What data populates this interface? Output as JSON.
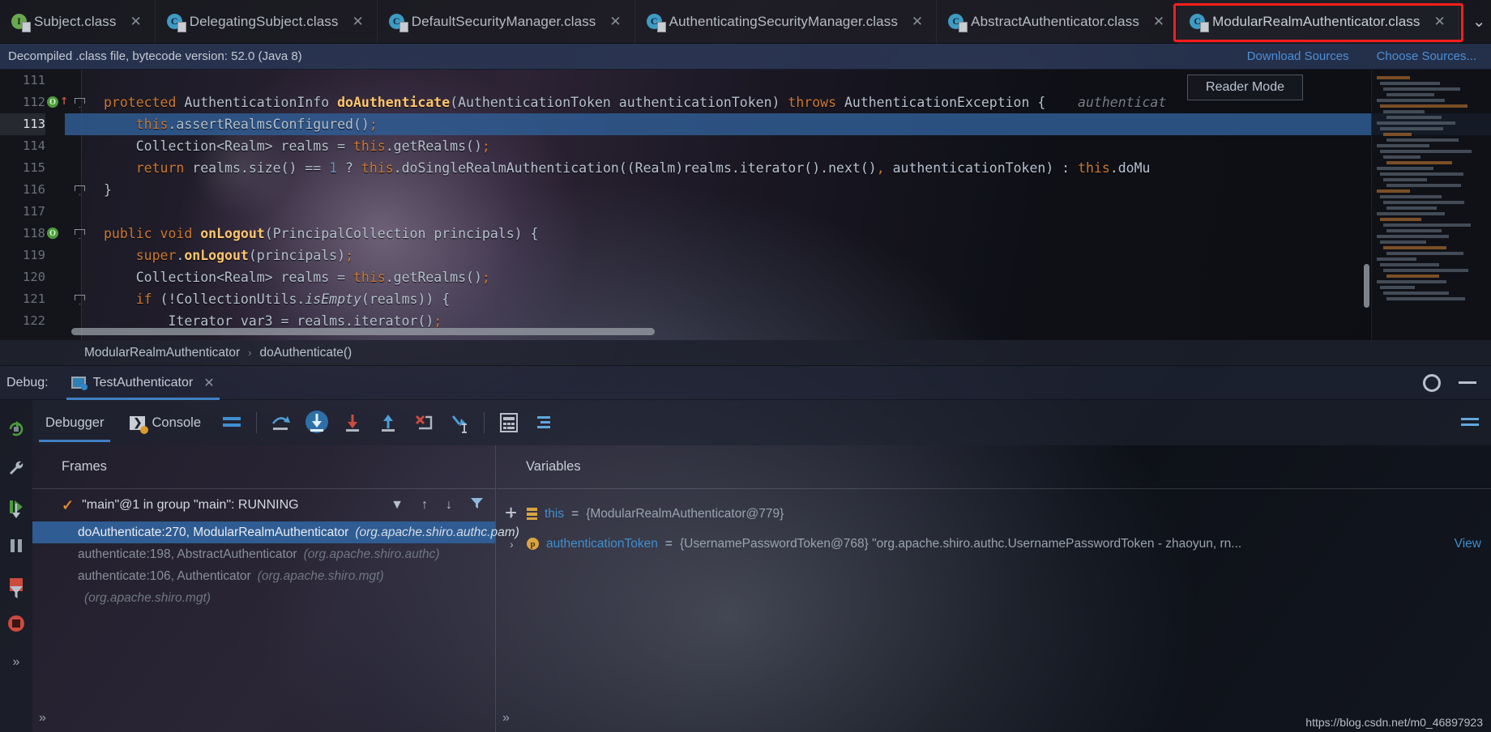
{
  "tabs": [
    {
      "label": "Subject.class",
      "icon": "interface-icon",
      "kind": "I",
      "active": false
    },
    {
      "label": "DelegatingSubject.class",
      "icon": "class-icon",
      "kind": "C",
      "active": false
    },
    {
      "label": "DefaultSecurityManager.class",
      "icon": "class-icon",
      "kind": "C",
      "active": false
    },
    {
      "label": "AuthenticatingSecurityManager.class",
      "icon": "class-icon",
      "kind": "C",
      "active": false
    },
    {
      "label": "AbstractAuthenticator.class",
      "icon": "class-icon",
      "kind": "C",
      "active": false
    },
    {
      "label": "ModularRealmAuthenticator.class",
      "icon": "class-icon",
      "kind": "C",
      "active": true
    }
  ],
  "tab_close_glyph": "✕",
  "tab_overflow_glyph": "⌄",
  "notification": {
    "message": "Decompiled .class file, bytecode version: 52.0 (Java 8)",
    "links": [
      "Download Sources",
      "Choose Sources..."
    ]
  },
  "editor": {
    "reader_mode_label": "Reader Mode",
    "highlighted_line": 113,
    "lines": [
      {
        "num": "111",
        "indent": 0,
        "text": ""
      },
      {
        "num": "112",
        "indent": 0,
        "text": "protected AuthenticationInfo doAuthenticate(AuthenticationToken authenticationToken) throws AuthenticationException {",
        "hint": "authenticat"
      },
      {
        "num": "113",
        "indent": 0,
        "text": "    this.assertRealmsConfigured();"
      },
      {
        "num": "114",
        "indent": 0,
        "text": "    Collection<Realm> realms = this.getRealms();"
      },
      {
        "num": "115",
        "indent": 0,
        "text": "    return realms.size() == 1 ? this.doSingleRealmAuthentication((Realm)realms.iterator().next(), authenticationToken) : this.doMu"
      },
      {
        "num": "116",
        "indent": 0,
        "text": "}"
      },
      {
        "num": "117",
        "indent": 0,
        "text": ""
      },
      {
        "num": "118",
        "indent": 0,
        "text": "public void onLogout(PrincipalCollection principals) {"
      },
      {
        "num": "119",
        "indent": 0,
        "text": "    super.onLogout(principals);"
      },
      {
        "num": "120",
        "indent": 0,
        "text": "    Collection<Realm> realms = this.getRealms();"
      },
      {
        "num": "121",
        "indent": 0,
        "text": "    if (!CollectionUtils.isEmpty(realms)) {"
      },
      {
        "num": "122",
        "indent": 0,
        "text": "        Iterator var3 = realms.iterator();"
      }
    ]
  },
  "breadcrumb": {
    "class": "ModularRealmAuthenticator",
    "separator": "›",
    "method": "doAuthenticate()"
  },
  "debug_window": {
    "title": "Debug:",
    "session_tab": "TestAuthenticator",
    "session_close_glyph": "✕",
    "gear_icon": "settings-icon",
    "minimize_icon": "minimize-icon",
    "tabs": [
      {
        "label": "Debugger",
        "selected": true
      },
      {
        "label": "Console",
        "selected": false
      }
    ],
    "toolbar_icons": [
      "layout-icon",
      "step-over-icon",
      "step-into-icon",
      "force-step-into-icon",
      "step-out-icon",
      "drop-frame-icon",
      "run-to-cursor-icon",
      "evaluate-expression-icon",
      "mute-breakpoints-icon"
    ],
    "left_strip_icons": [
      "rerun-icon",
      "wrench-icon",
      "resume-icon",
      "pause-icon",
      "stop-icon",
      "stop-all-icon",
      "expand-icon"
    ]
  },
  "frames": {
    "header": "Frames",
    "thread": "\"main\"@1 in group \"main\": RUNNING",
    "thread_status_icon": "check-icon",
    "dropdown_glyph": "▼",
    "up_glyph": "↑",
    "down_glyph": "↓",
    "filter_glyph": "filter-icon",
    "items": [
      {
        "method": "doAuthenticate:270, ModularRealmAuthenticator",
        "package": "(org.apache.shiro.authc.pam)",
        "selected": true
      },
      {
        "method": "authenticate:198, AbstractAuthenticator",
        "package": "(org.apache.shiro.authc)",
        "selected": false
      },
      {
        "method": "authenticate:106, Authenticator",
        "package": "(org.apache.shiro.mgt)",
        "selected": false
      },
      {
        "method": "",
        "package": "(org.apache.shiro.mgt)",
        "selected": false
      }
    ],
    "overflow_glyph": "»"
  },
  "variables": {
    "header": "Variables",
    "add_glyph": "+",
    "expand_glyph": "›",
    "items": [
      {
        "icon": "field-icon",
        "name": "this",
        "eq": " = ",
        "value": "{ModularRealmAuthenticator@779}",
        "more": ""
      },
      {
        "icon": "parameter-icon",
        "name": "authenticationToken",
        "eq": " = ",
        "value": "{UsernamePasswordToken@768} \"org.apache.shiro.authc.UsernamePasswordToken - zhaoyun, rn...",
        "more": "View"
      }
    ]
  },
  "watermark": "https://blog.csdn.net/m0_46897923",
  "colors": {
    "accent_blue": "#3f7fc4",
    "selection_blue": "#2f5c92",
    "keyword_orange": "#cc7832",
    "method_yellow": "#ffc66d",
    "number_blue": "#6897bb",
    "link_blue": "#4d8fd6",
    "highlight_red": "#ff1d1d",
    "text_default": "#b6c2cf"
  }
}
